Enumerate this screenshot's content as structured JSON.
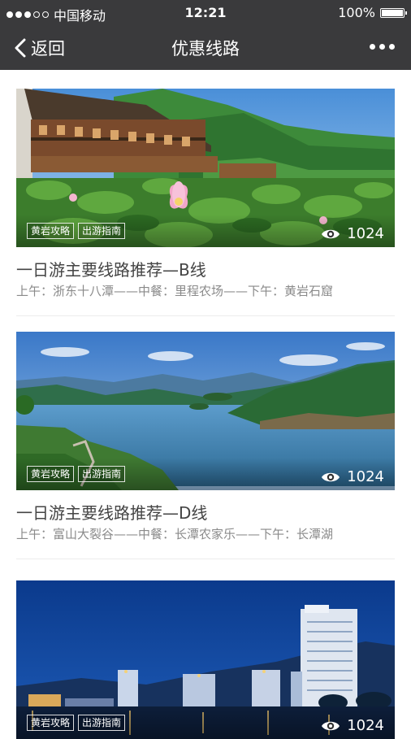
{
  "status_bar": {
    "carrier": "中国移动",
    "time": "12:21",
    "battery": "100%"
  },
  "nav": {
    "back_label": "返回",
    "title": "优惠线路"
  },
  "routes": [
    {
      "tags": [
        "黄岩攻略",
        "出游指南"
      ],
      "views": "1024",
      "title": "一日游主要线路推荐—B线",
      "desc": "上午：浙东十八潭——中餐：里程农场——下午：黄岩石窟"
    },
    {
      "tags": [
        "黄岩攻略",
        "出游指南"
      ],
      "views": "1024",
      "title": "一日游主要线路推荐—D线",
      "desc": "上午：富山大裂谷——中餐：长潭农家乐——下午：长潭湖"
    },
    {
      "tags": [
        "黄岩攻略",
        "出游指南"
      ],
      "views": "1024"
    }
  ]
}
